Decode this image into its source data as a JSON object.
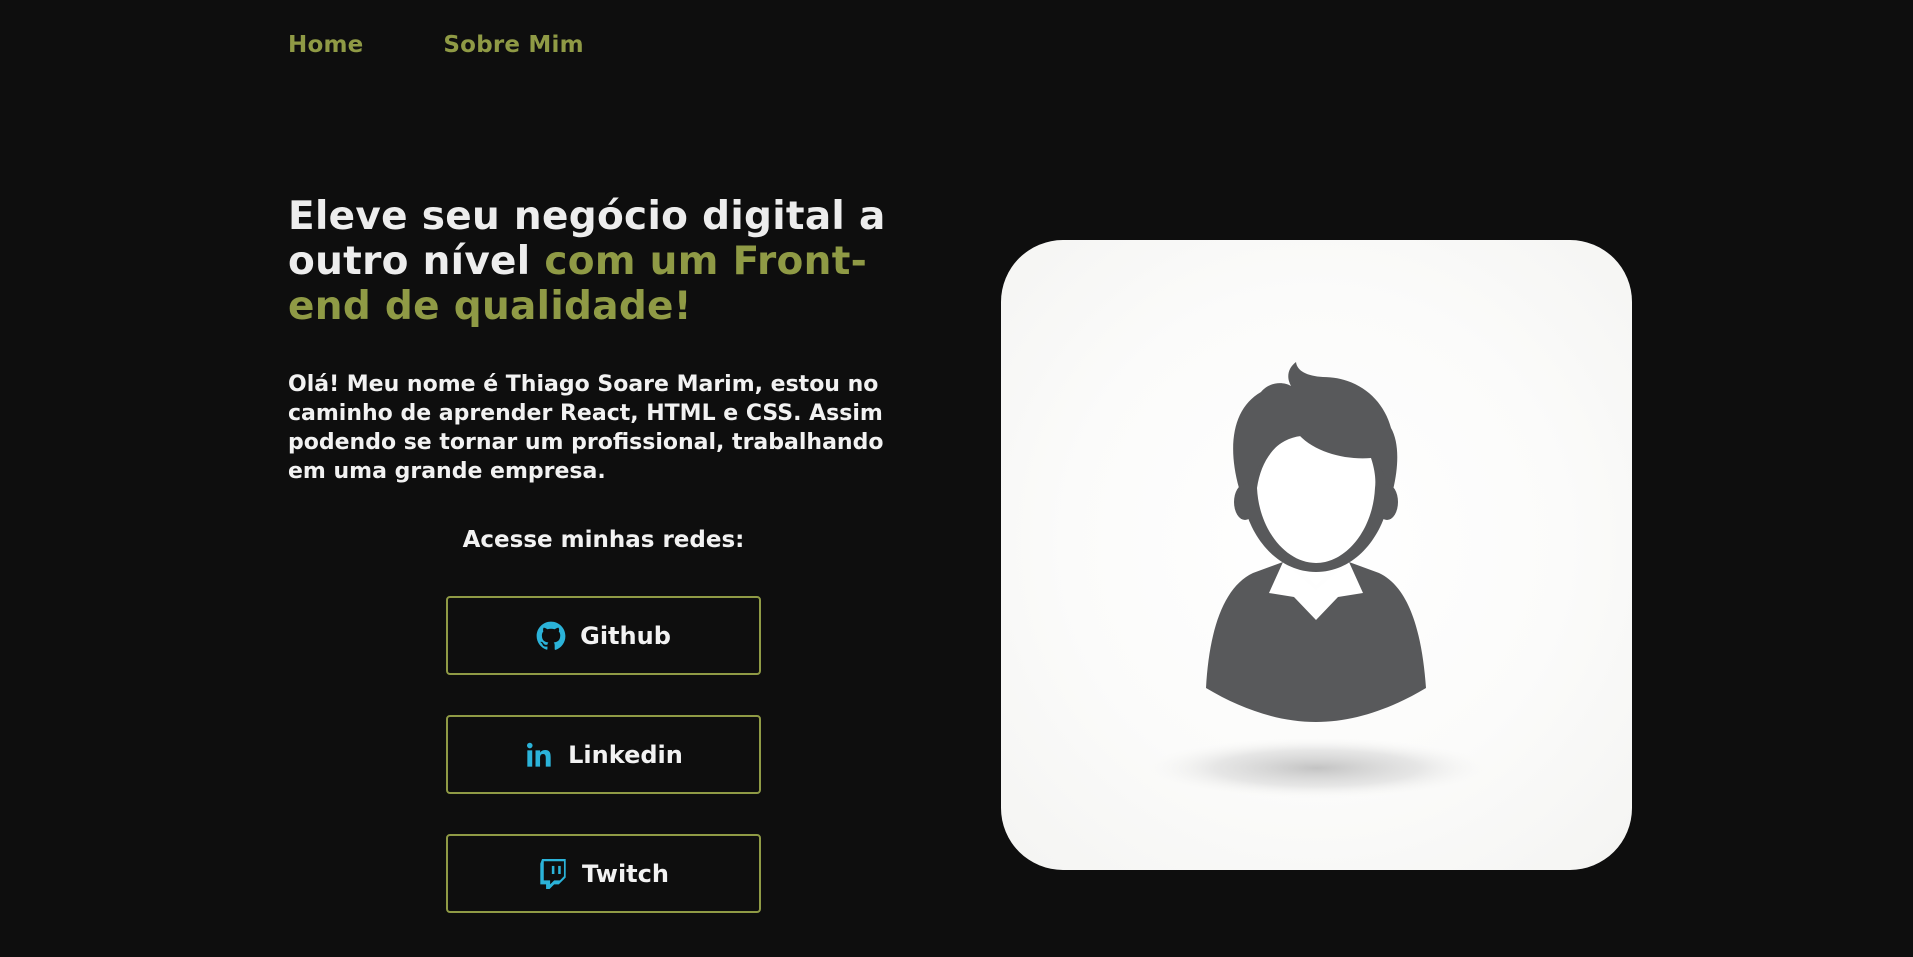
{
  "nav": {
    "items": [
      {
        "label": "Home"
      },
      {
        "label": "Sobre Mim"
      }
    ]
  },
  "hero": {
    "headline_white": "Eleve seu negócio digital a outro nível ",
    "headline_accent": "com um Front-end de qualidade!",
    "intro": "Olá! Meu nome é Thiago Soare Marim, estou no caminho de aprender React, HTML e CSS. Assim podendo se tornar um profissional, trabalhando em uma grande empresa."
  },
  "socials": {
    "title": "Acesse minhas redes:",
    "buttons": [
      {
        "label": "Github",
        "icon": "github-icon"
      },
      {
        "label": "Linkedin",
        "icon": "linkedin-icon"
      },
      {
        "label": "Twitch",
        "icon": "twitch-icon"
      }
    ]
  },
  "colors": {
    "background": "#0e0e0e",
    "accent": "#8f9a45",
    "text": "#f2f2f2",
    "icon": "#2bb3d9",
    "avatar_gray": "#58595b"
  }
}
